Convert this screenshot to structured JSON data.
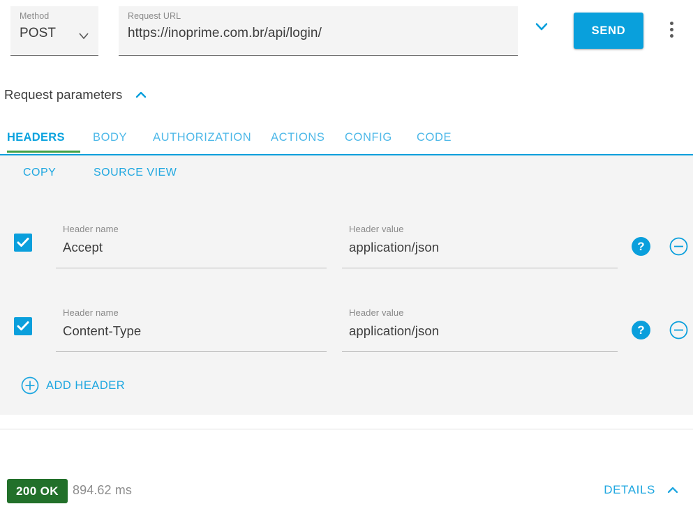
{
  "request_bar": {
    "method": {
      "label": "Method",
      "value": "POST",
      "chevron_icon": "chevron-down-icon"
    },
    "url": {
      "label": "Request URL",
      "value": "https://inoprime.com.br/api/login/"
    },
    "expand_icon": "chevron-down-icon",
    "send_label": "SEND",
    "more_icon": "kebab-menu-icon",
    "accent_color": "#09a0dc"
  },
  "params_section": {
    "title": "Request parameters",
    "collapse_icon": "chevron-up-icon",
    "tabs": [
      {
        "label": "HEADERS",
        "active": true
      },
      {
        "label": "BODY",
        "active": false
      },
      {
        "label": "AUTHORIZATION",
        "active": false
      },
      {
        "label": "ACTIONS",
        "active": false
      },
      {
        "label": "CONFIG",
        "active": false
      },
      {
        "label": "CODE",
        "active": false
      }
    ],
    "active_tab_indicator_color": "#43a047",
    "tab_rule_color": "#0a9fdc"
  },
  "headers_panel": {
    "actions": {
      "copy_label": "COPY",
      "source_view_label": "SOURCE VIEW"
    },
    "rows": [
      {
        "enabled": true,
        "name_label": "Header name",
        "name_value": "Accept",
        "value_label": "Header value",
        "value_value": "application/json",
        "help_icon": "help-icon",
        "remove_icon": "remove-circle-icon"
      },
      {
        "enabled": true,
        "name_label": "Header name",
        "name_value": "Content-Type",
        "value_label": "Header value",
        "value_value": "application/json",
        "help_icon": "help-icon",
        "remove_icon": "remove-circle-icon"
      }
    ],
    "add_header": {
      "label": "ADD HEADER",
      "icon": "add-circle-icon"
    }
  },
  "status_bar": {
    "status_code": "200 OK",
    "status_color": "#22702a",
    "time": "894.62 ms",
    "details_label": "DETAILS",
    "details_icon": "chevron-up-icon"
  }
}
